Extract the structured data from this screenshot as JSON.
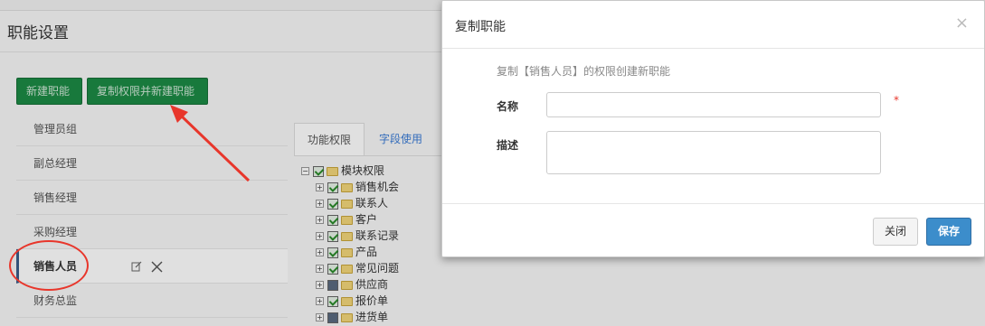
{
  "page": {
    "title": "职能设置",
    "buttons": {
      "new_role": "新建职能",
      "copy_role": "复制权限并新建职能"
    },
    "roles": [
      {
        "label": "管理员组",
        "active": false
      },
      {
        "label": "副总经理",
        "active": false
      },
      {
        "label": "销售经理",
        "active": false
      },
      {
        "label": "采购经理",
        "active": false
      },
      {
        "label": "销售人员",
        "active": true
      },
      {
        "label": "财务总监",
        "active": false
      }
    ],
    "role_actions": {
      "edit_icon": "edit-icon",
      "delete_icon": "close-icon"
    },
    "tabs": [
      {
        "label": "功能权限",
        "active": true
      },
      {
        "label": "字段使用",
        "active": false
      }
    ],
    "tree": {
      "root": {
        "label": "模块权限",
        "checked": true
      },
      "children": [
        {
          "label": "销售机会",
          "state": "checked"
        },
        {
          "label": "联系人",
          "state": "checked"
        },
        {
          "label": "客户",
          "state": "checked"
        },
        {
          "label": "联系记录",
          "state": "checked"
        },
        {
          "label": "产品",
          "state": "checked"
        },
        {
          "label": "常见问题",
          "state": "checked"
        },
        {
          "label": "供应商",
          "state": "partial"
        },
        {
          "label": "报价单",
          "state": "checked"
        },
        {
          "label": "进货单",
          "state": "partial"
        }
      ]
    }
  },
  "modal": {
    "title": "复制职能",
    "hint": "复制【销售人员】的权限创建新职能",
    "name_label": "名称",
    "name_value": "",
    "required_mark": "*",
    "desc_label": "描述",
    "desc_value": "",
    "close_button": "关闭",
    "save_button": "保存"
  },
  "colors": {
    "green_button": "#1c8a45",
    "save_button": "#3c8dcb",
    "annotation_red": "#e8362b",
    "tab_link": "#3a7bd5"
  }
}
